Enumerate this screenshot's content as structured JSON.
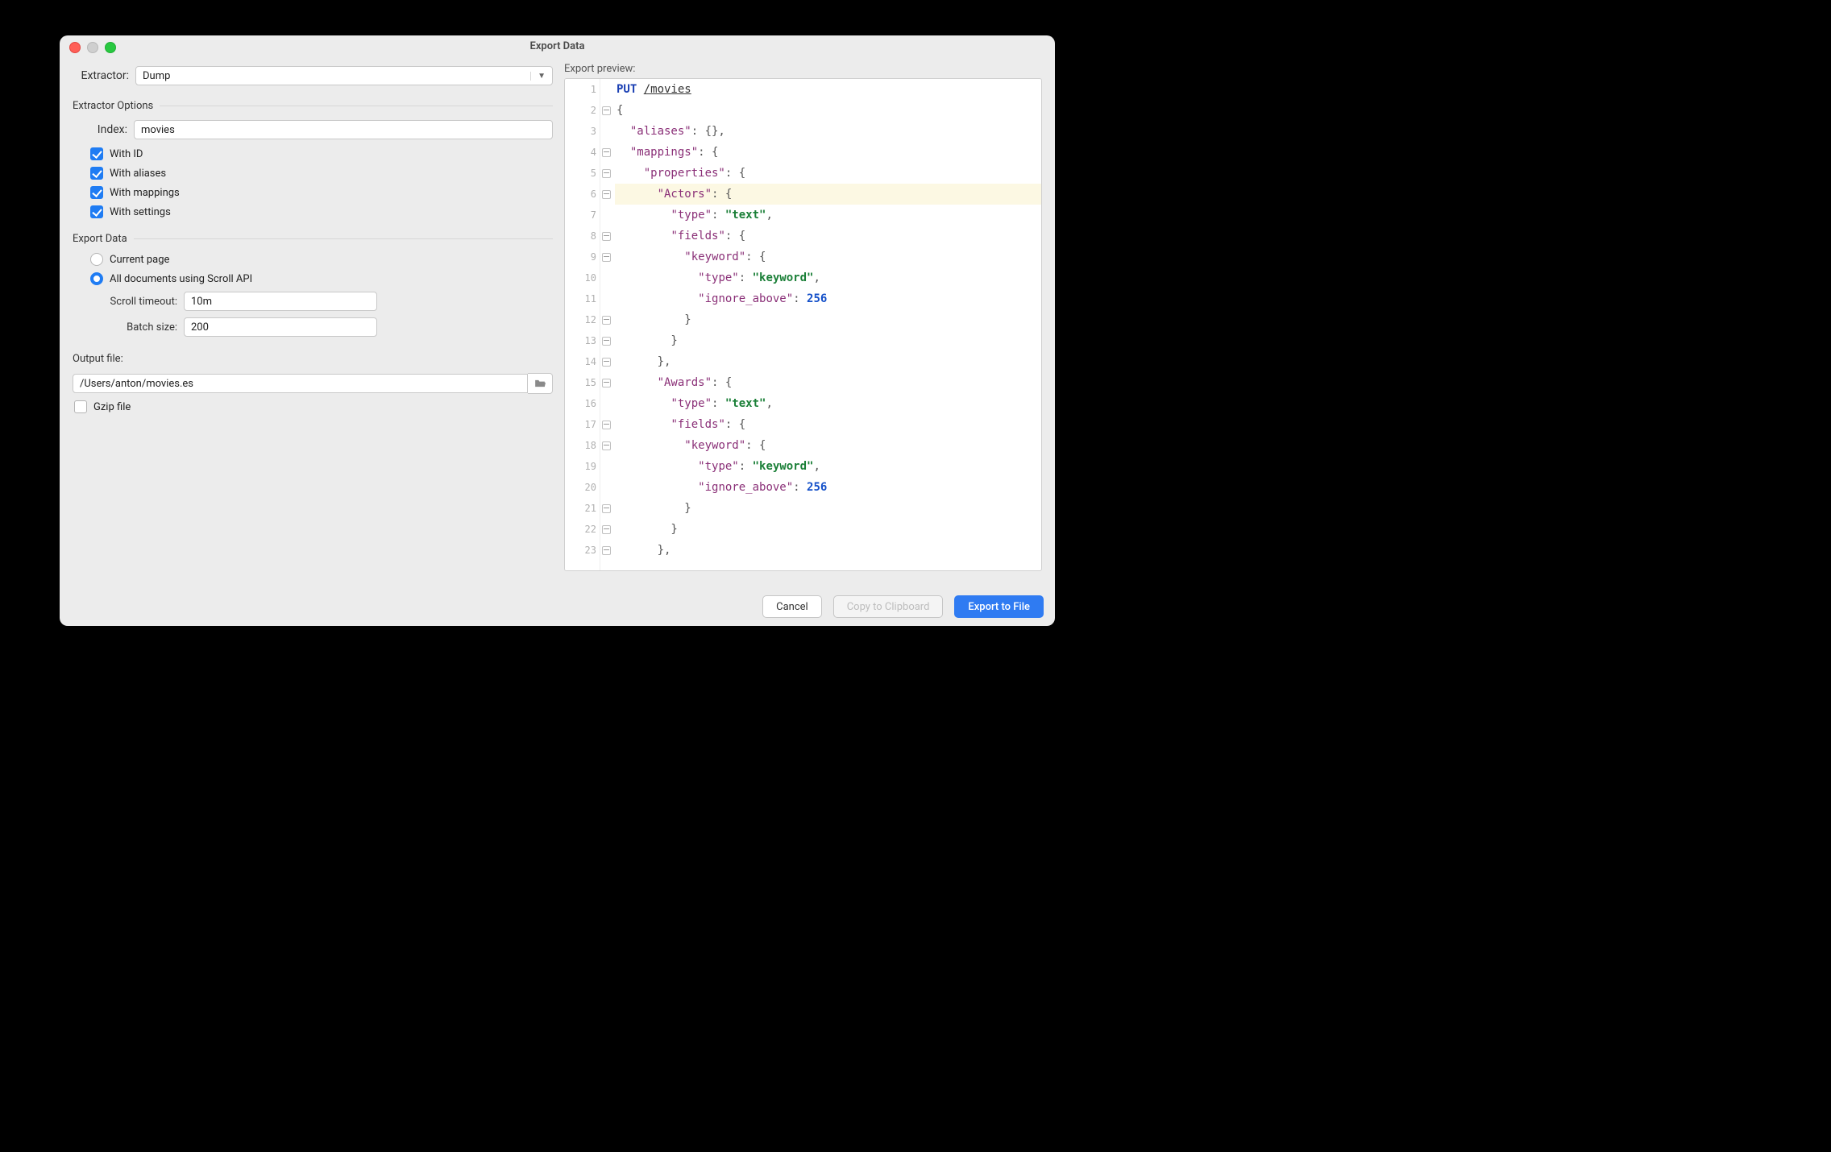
{
  "title": "Export Data",
  "extractor": {
    "label": "Extractor:",
    "value": "Dump"
  },
  "extractor_options": {
    "section_title": "Extractor Options",
    "index_label": "Index:",
    "index_value": "movies",
    "with_id": "With ID",
    "with_aliases": "With aliases",
    "with_mappings": "With mappings",
    "with_settings": "With settings"
  },
  "export_data": {
    "section_title": "Export Data",
    "current_page": "Current page",
    "all_docs": "All documents using Scroll API",
    "scroll_timeout_label": "Scroll timeout:",
    "scroll_timeout_value": "10m",
    "batch_size_label": "Batch size:",
    "batch_size_value": "200"
  },
  "output": {
    "label": "Output file:",
    "path": "/Users/anton/movies.es",
    "gzip": "Gzip file"
  },
  "preview": {
    "label": "Export preview:",
    "method": "PUT",
    "path": "/movies"
  },
  "buttons": {
    "cancel": "Cancel",
    "copy": "Copy to Clipboard",
    "export": "Export to File"
  },
  "preview_code": [
    {
      "n": 1,
      "fold": false,
      "hl": false,
      "tokens": [
        {
          "t": "PUT ",
          "c": "kw"
        },
        {
          "t": "/movies",
          "c": "url"
        }
      ]
    },
    {
      "n": 2,
      "fold": true,
      "hl": false,
      "tokens": [
        {
          "t": "{",
          "c": "pun"
        }
      ]
    },
    {
      "n": 3,
      "fold": false,
      "hl": false,
      "tokens": [
        {
          "t": "  ",
          "c": "pun"
        },
        {
          "t": "\"aliases\"",
          "c": "prop"
        },
        {
          "t": ": {},",
          "c": "pun"
        }
      ]
    },
    {
      "n": 4,
      "fold": true,
      "hl": false,
      "tokens": [
        {
          "t": "  ",
          "c": "pun"
        },
        {
          "t": "\"mappings\"",
          "c": "prop"
        },
        {
          "t": ": {",
          "c": "pun"
        }
      ]
    },
    {
      "n": 5,
      "fold": true,
      "hl": false,
      "tokens": [
        {
          "t": "    ",
          "c": "pun"
        },
        {
          "t": "\"properties\"",
          "c": "prop"
        },
        {
          "t": ": {",
          "c": "pun"
        }
      ]
    },
    {
      "n": 6,
      "fold": true,
      "hl": true,
      "tokens": [
        {
          "t": "      ",
          "c": "pun"
        },
        {
          "t": "\"Actors\"",
          "c": "prop"
        },
        {
          "t": ": {",
          "c": "pun"
        }
      ]
    },
    {
      "n": 7,
      "fold": false,
      "hl": false,
      "tokens": [
        {
          "t": "        ",
          "c": "pun"
        },
        {
          "t": "\"type\"",
          "c": "prop"
        },
        {
          "t": ": ",
          "c": "pun"
        },
        {
          "t": "\"text\"",
          "c": "str"
        },
        {
          "t": ",",
          "c": "pun"
        }
      ]
    },
    {
      "n": 8,
      "fold": true,
      "hl": false,
      "tokens": [
        {
          "t": "        ",
          "c": "pun"
        },
        {
          "t": "\"fields\"",
          "c": "prop"
        },
        {
          "t": ": {",
          "c": "pun"
        }
      ]
    },
    {
      "n": 9,
      "fold": true,
      "hl": false,
      "tokens": [
        {
          "t": "          ",
          "c": "pun"
        },
        {
          "t": "\"keyword\"",
          "c": "prop"
        },
        {
          "t": ": {",
          "c": "pun"
        }
      ]
    },
    {
      "n": 10,
      "fold": false,
      "hl": false,
      "tokens": [
        {
          "t": "            ",
          "c": "pun"
        },
        {
          "t": "\"type\"",
          "c": "prop"
        },
        {
          "t": ": ",
          "c": "pun"
        },
        {
          "t": "\"keyword\"",
          "c": "str"
        },
        {
          "t": ",",
          "c": "pun"
        }
      ]
    },
    {
      "n": 11,
      "fold": false,
      "hl": false,
      "tokens": [
        {
          "t": "            ",
          "c": "pun"
        },
        {
          "t": "\"ignore_above\"",
          "c": "prop"
        },
        {
          "t": ": ",
          "c": "pun"
        },
        {
          "t": "256",
          "c": "num"
        }
      ]
    },
    {
      "n": 12,
      "fold": true,
      "hl": false,
      "tokens": [
        {
          "t": "          }",
          "c": "pun"
        }
      ]
    },
    {
      "n": 13,
      "fold": true,
      "hl": false,
      "tokens": [
        {
          "t": "        }",
          "c": "pun"
        }
      ]
    },
    {
      "n": 14,
      "fold": true,
      "hl": false,
      "tokens": [
        {
          "t": "      },",
          "c": "pun"
        }
      ]
    },
    {
      "n": 15,
      "fold": true,
      "hl": false,
      "tokens": [
        {
          "t": "      ",
          "c": "pun"
        },
        {
          "t": "\"Awards\"",
          "c": "prop"
        },
        {
          "t": ": {",
          "c": "pun"
        }
      ]
    },
    {
      "n": 16,
      "fold": false,
      "hl": false,
      "tokens": [
        {
          "t": "        ",
          "c": "pun"
        },
        {
          "t": "\"type\"",
          "c": "prop"
        },
        {
          "t": ": ",
          "c": "pun"
        },
        {
          "t": "\"text\"",
          "c": "str"
        },
        {
          "t": ",",
          "c": "pun"
        }
      ]
    },
    {
      "n": 17,
      "fold": true,
      "hl": false,
      "tokens": [
        {
          "t": "        ",
          "c": "pun"
        },
        {
          "t": "\"fields\"",
          "c": "prop"
        },
        {
          "t": ": {",
          "c": "pun"
        }
      ]
    },
    {
      "n": 18,
      "fold": true,
      "hl": false,
      "tokens": [
        {
          "t": "          ",
          "c": "pun"
        },
        {
          "t": "\"keyword\"",
          "c": "prop"
        },
        {
          "t": ": {",
          "c": "pun"
        }
      ]
    },
    {
      "n": 19,
      "fold": false,
      "hl": false,
      "tokens": [
        {
          "t": "            ",
          "c": "pun"
        },
        {
          "t": "\"type\"",
          "c": "prop"
        },
        {
          "t": ": ",
          "c": "pun"
        },
        {
          "t": "\"keyword\"",
          "c": "str"
        },
        {
          "t": ",",
          "c": "pun"
        }
      ]
    },
    {
      "n": 20,
      "fold": false,
      "hl": false,
      "tokens": [
        {
          "t": "            ",
          "c": "pun"
        },
        {
          "t": "\"ignore_above\"",
          "c": "prop"
        },
        {
          "t": ": ",
          "c": "pun"
        },
        {
          "t": "256",
          "c": "num"
        }
      ]
    },
    {
      "n": 21,
      "fold": true,
      "hl": false,
      "tokens": [
        {
          "t": "          }",
          "c": "pun"
        }
      ]
    },
    {
      "n": 22,
      "fold": true,
      "hl": false,
      "tokens": [
        {
          "t": "        }",
          "c": "pun"
        }
      ]
    },
    {
      "n": 23,
      "fold": true,
      "hl": false,
      "tokens": [
        {
          "t": "      },",
          "c": "pun"
        }
      ]
    }
  ]
}
